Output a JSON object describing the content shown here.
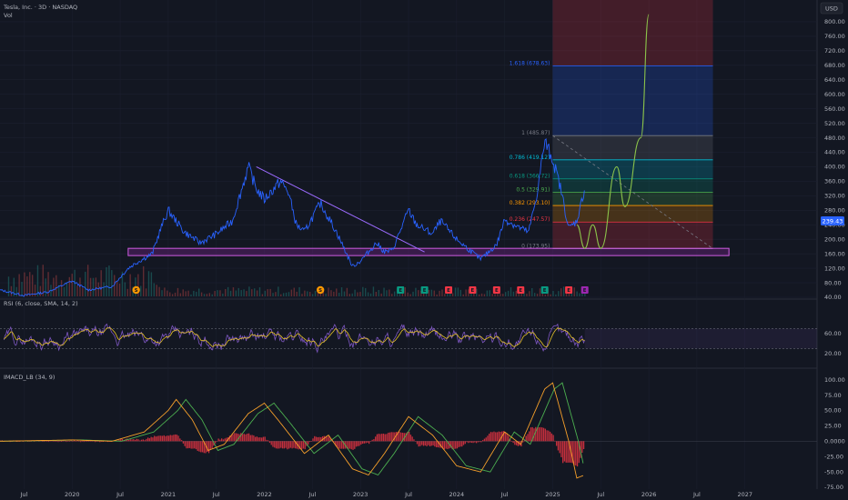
{
  "header": {
    "symbol": "Tesla, Inc. · 3D · NASDAQ",
    "vol_label": "Vol",
    "currency": "USD",
    "last_price": "239.43",
    "rsi_label": "RSI (6, close, SMA, 14, 2)",
    "macd_label": "IMACD_LB (34, 9)"
  },
  "colors": {
    "background": "#131722",
    "price_line": "#2962ff",
    "rsi_line": "#7e57c2",
    "rsi_signal": "#e6c229",
    "macd_fast": "#f59f2a",
    "macd_slow": "#4caf50",
    "macd_hist": "#f23645",
    "support_box": "#9c27b0",
    "projection": "#8bc34a",
    "trendline": "#9c6bff",
    "last_price_tag": "#2962ff"
  },
  "chart_data": [
    {
      "type": "line",
      "panel": "price",
      "ylim": [
        40,
        840
      ],
      "x_range": [
        "2019-04",
        "2027-10"
      ],
      "price_ticks": [
        "40.00",
        "80.00",
        "120.00",
        "160.00",
        "200.00",
        "240.00",
        "280.00",
        "320.00",
        "360.00",
        "400.00",
        "440.00",
        "480.00",
        "520.00",
        "560.00",
        "600.00",
        "640.00",
        "680.00",
        "720.00",
        "760.00",
        "800.00"
      ],
      "series": [
        {
          "points": [
            [
              "2019-04",
              60
            ],
            [
              "2019-07",
              45
            ],
            [
              "2019-10",
              55
            ],
            [
              "2020-01",
              85
            ],
            [
              "2020-03",
              60
            ],
            [
              "2020-06",
              70
            ],
            [
              "2020-08",
              120
            ],
            [
              "2020-09",
              135
            ],
            [
              "2020-11",
              160
            ],
            [
              "2020-12",
              225
            ],
            [
              "2021-01",
              280
            ],
            [
              "2021-03",
              220
            ],
            [
              "2021-05",
              190
            ],
            [
              "2021-07",
              215
            ],
            [
              "2021-09",
              250
            ],
            [
              "2021-11",
              400
            ],
            [
              "2021-12",
              340
            ],
            [
              "2022-01",
              310
            ],
            [
              "2022-03",
              360
            ],
            [
              "2022-04",
              330
            ],
            [
              "2022-05",
              240
            ],
            [
              "2022-06",
              220
            ],
            [
              "2022-08",
              300
            ],
            [
              "2022-10",
              220
            ],
            [
              "2022-12",
              125
            ],
            [
              "2023-01",
              140
            ],
            [
              "2023-03",
              190
            ],
            [
              "2023-04",
              165
            ],
            [
              "2023-05",
              170
            ],
            [
              "2023-07",
              280
            ],
            [
              "2023-08",
              240
            ],
            [
              "2023-10",
              215
            ],
            [
              "2023-11",
              250
            ],
            [
              "2024-01",
              200
            ],
            [
              "2024-04",
              145
            ],
            [
              "2024-06",
              185
            ],
            [
              "2024-07",
              255
            ],
            [
              "2024-09",
              230
            ],
            [
              "2024-10",
              220
            ],
            [
              "2024-11",
              320
            ],
            [
              "2024-12",
              470
            ],
            [
              "2025-01",
              420
            ],
            [
              "2025-02",
              340
            ],
            [
              "2025-03",
              230
            ],
            [
              "2025-04",
              250
            ],
            [
              "2025-05",
              340
            ]
          ]
        }
      ],
      "projection": {
        "points": [
          [
            "2025-04",
            240
          ],
          [
            "2025-05",
            175
          ],
          [
            "2025-06",
            240
          ],
          [
            "2025-07",
            175
          ],
          [
            "2025-09",
            400
          ],
          [
            "2025-10",
            290
          ],
          [
            "2025-12",
            480
          ],
          [
            "2026-01",
            820
          ]
        ]
      },
      "trendline": [
        [
          "2021-12",
          400
        ],
        [
          "2023-09",
          165
        ]
      ],
      "support_zone": [
        155,
        175
      ],
      "fib_start_date": "2025-01",
      "fib_end_date": "2026-09",
      "fib_levels": [
        {
          "ratio": "0",
          "label": "0 (173.95)",
          "value": 173.95,
          "color": "#787b86"
        },
        {
          "ratio": "0.236",
          "label": "0.236 (247.57)",
          "value": 247.57,
          "color": "#f23645"
        },
        {
          "ratio": "0.382",
          "label": "0.382 (293.10)",
          "value": 293.1,
          "color": "#ff9800"
        },
        {
          "ratio": "0.5",
          "label": "0.5 (329.91)",
          "value": 329.91,
          "color": "#4caf50"
        },
        {
          "ratio": "0.618",
          "label": "0.618 (366.72)",
          "value": 366.72,
          "color": "#089981"
        },
        {
          "ratio": "0.786",
          "label": "0.786 (419.12)",
          "value": 419.12,
          "color": "#00bcd4"
        },
        {
          "ratio": "1",
          "label": "1 (485.87)",
          "value": 485.87,
          "color": "#787b86"
        },
        {
          "ratio": "1.618",
          "label": "1.618 (678.63)",
          "value": 678.63,
          "color": "#2962ff"
        }
      ],
      "events": [
        {
          "date": "2020-09",
          "label": "S",
          "color": "#ff9800"
        },
        {
          "date": "2022-08",
          "label": "S",
          "color": "#ff9800"
        },
        {
          "date": "2023-06",
          "label": "E",
          "color": "#089981"
        },
        {
          "date": "2023-09",
          "label": "E",
          "color": "#089981"
        },
        {
          "date": "2023-12",
          "label": "E",
          "color": "#f23645"
        },
        {
          "date": "2024-03",
          "label": "E",
          "color": "#f23645"
        },
        {
          "date": "2024-06",
          "label": "E",
          "color": "#f23645"
        },
        {
          "date": "2024-09",
          "label": "E",
          "color": "#f23645"
        },
        {
          "date": "2024-12",
          "label": "E",
          "color": "#089981"
        },
        {
          "date": "2025-03",
          "label": "E",
          "color": "#f23645"
        },
        {
          "date": "2025-05",
          "label": "E",
          "color": "#9c27b0"
        }
      ]
    },
    {
      "type": "line",
      "panel": "rsi",
      "ylim": [
        0,
        100
      ],
      "ticks": [
        "20.00",
        "60.00"
      ],
      "bands": [
        30,
        70
      ]
    },
    {
      "type": "area",
      "panel": "macd",
      "ylim": [
        -75,
        110
      ],
      "ticks": [
        "100.00",
        "75.00",
        "50.00",
        "25.00",
        "0.0000",
        "-25.00",
        "-50.00",
        "-75.00"
      ],
      "series": [
        {
          "points": [
            [
              "2019-04",
              0
            ],
            [
              "2020-01",
              2
            ],
            [
              "2020-06",
              0
            ],
            [
              "2020-10",
              15
            ],
            [
              "2021-01",
              50
            ],
            [
              "2021-02",
              68
            ],
            [
              "2021-04",
              35
            ],
            [
              "2021-06",
              -15
            ],
            [
              "2021-08",
              -5
            ],
            [
              "2021-11",
              45
            ],
            [
              "2022-01",
              62
            ],
            [
              "2022-03",
              30
            ],
            [
              "2022-06",
              -20
            ],
            [
              "2022-09",
              10
            ],
            [
              "2022-12",
              -45
            ],
            [
              "2023-02",
              -55
            ],
            [
              "2023-04",
              -20
            ],
            [
              "2023-07",
              40
            ],
            [
              "2023-10",
              10
            ],
            [
              "2024-01",
              -40
            ],
            [
              "2024-04",
              -50
            ],
            [
              "2024-07",
              15
            ],
            [
              "2024-09",
              -5
            ],
            [
              "2024-12",
              85
            ],
            [
              "2025-01",
              95
            ],
            [
              "2025-03",
              0
            ],
            [
              "2025-04",
              -60
            ],
            [
              "2025-05",
              -55
            ]
          ]
        }
      ]
    }
  ],
  "x_axis_labels": [
    "Jul",
    "2020",
    "Jul",
    "2021",
    "Jul",
    "2022",
    "Jul",
    "2023",
    "Jul",
    "2024",
    "Jul",
    "2025",
    "Jul",
    "2026",
    "Jul",
    "2027"
  ]
}
